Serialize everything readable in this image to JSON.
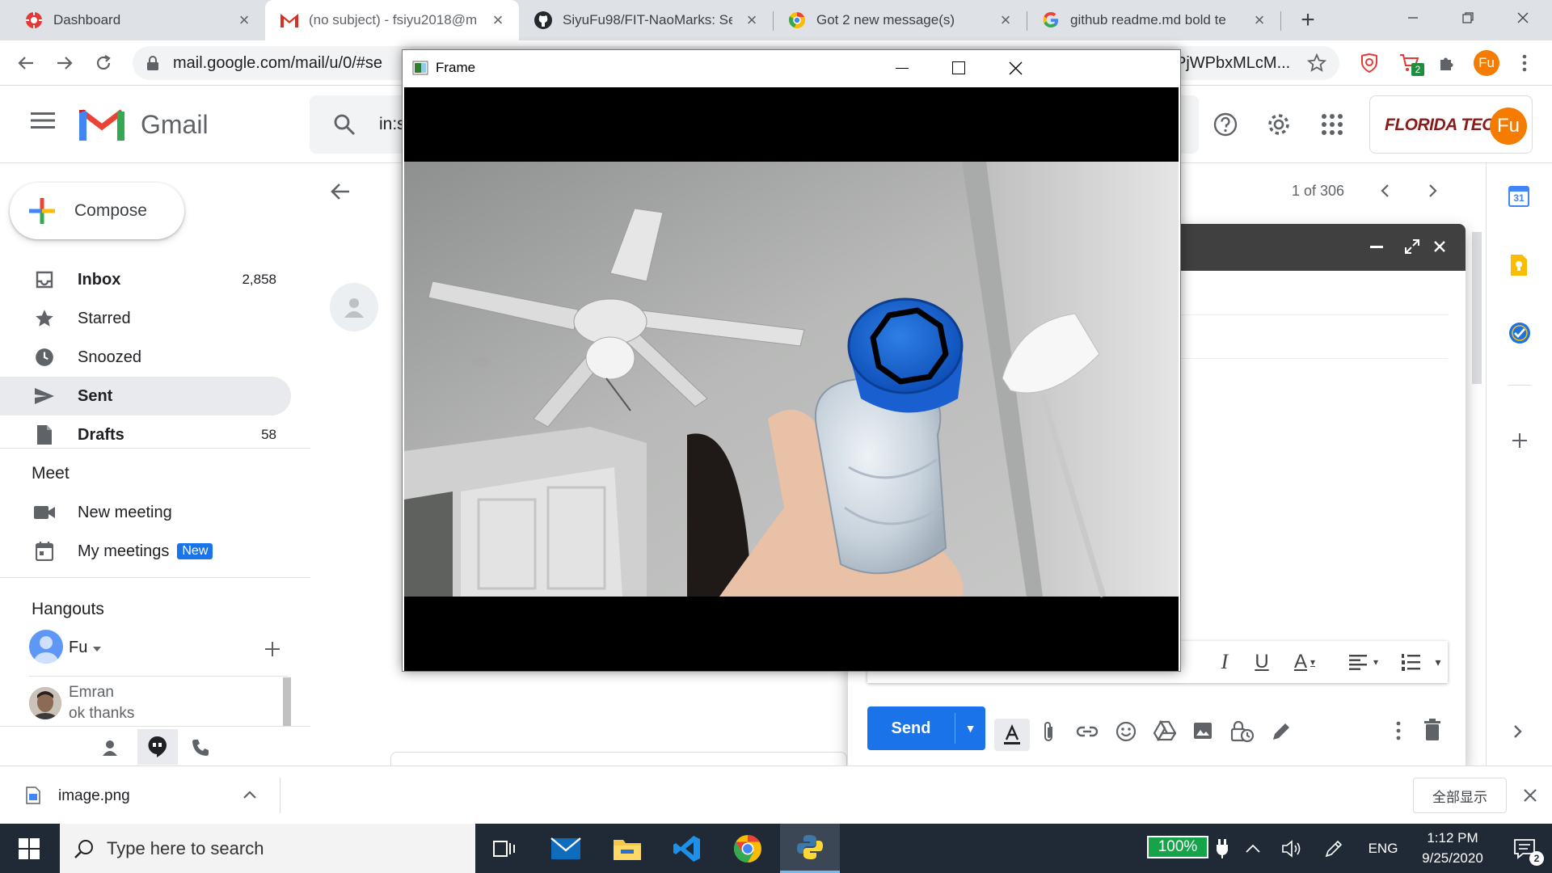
{
  "browser": {
    "tabs": [
      {
        "title": "Dashboard",
        "icon": "dashboard-favicon"
      },
      {
        "title": "(no subject) - fsiyu2018@m",
        "icon": "gmail-favicon"
      },
      {
        "title": "SiyuFu98/FIT-NaoMarks: Se",
        "icon": "github-favicon"
      },
      {
        "title": "Got 2 new message(s)",
        "icon": "chrome-apps-favicon"
      },
      {
        "title": "github readme.md bold te",
        "icon": "google-favicon"
      }
    ],
    "new_tab_symbol": "+",
    "url": "mail.google.com/mail/u/0/#se",
    "url_tail": "PjWPbxMLcM...",
    "extension_badge": "2",
    "profile_initials": "Fu"
  },
  "gmail": {
    "brand": "Gmail",
    "search_text": "in:s",
    "org_logo_text": "FLORIDA TECH",
    "account_initials": "Fu",
    "compose_label": "Compose",
    "nav": [
      {
        "label": "Inbox",
        "count": "2,858",
        "icon": "inbox-icon",
        "bold": true
      },
      {
        "label": "Starred",
        "count": "",
        "icon": "star-icon",
        "bold": false
      },
      {
        "label": "Snoozed",
        "count": "",
        "icon": "clock-icon",
        "bold": false
      },
      {
        "label": "Sent",
        "count": "",
        "icon": "send-icon",
        "bold": true
      },
      {
        "label": "Drafts",
        "count": "58",
        "icon": "draft-icon",
        "bold": true
      }
    ],
    "meet": {
      "title": "Meet",
      "new_meeting": "New meeting",
      "my_meetings": "My meetings",
      "new_badge": "New"
    },
    "hangouts": {
      "title": "Hangouts",
      "user": "Fu",
      "contact_name": "Emran",
      "contact_message": "ok thanks"
    },
    "pagination": "1 of 306",
    "calendar_day": "31"
  },
  "frame_window": {
    "title": "Frame"
  },
  "compose_window": {
    "send_label": "Send"
  },
  "download": {
    "filename": "image.png",
    "show_all": "全部显示"
  },
  "taskbar": {
    "search_placeholder": "Type here to search",
    "battery": "100%",
    "language": "ENG",
    "time": "1:12 PM",
    "date": "9/25/2020",
    "notification_count": "2"
  }
}
